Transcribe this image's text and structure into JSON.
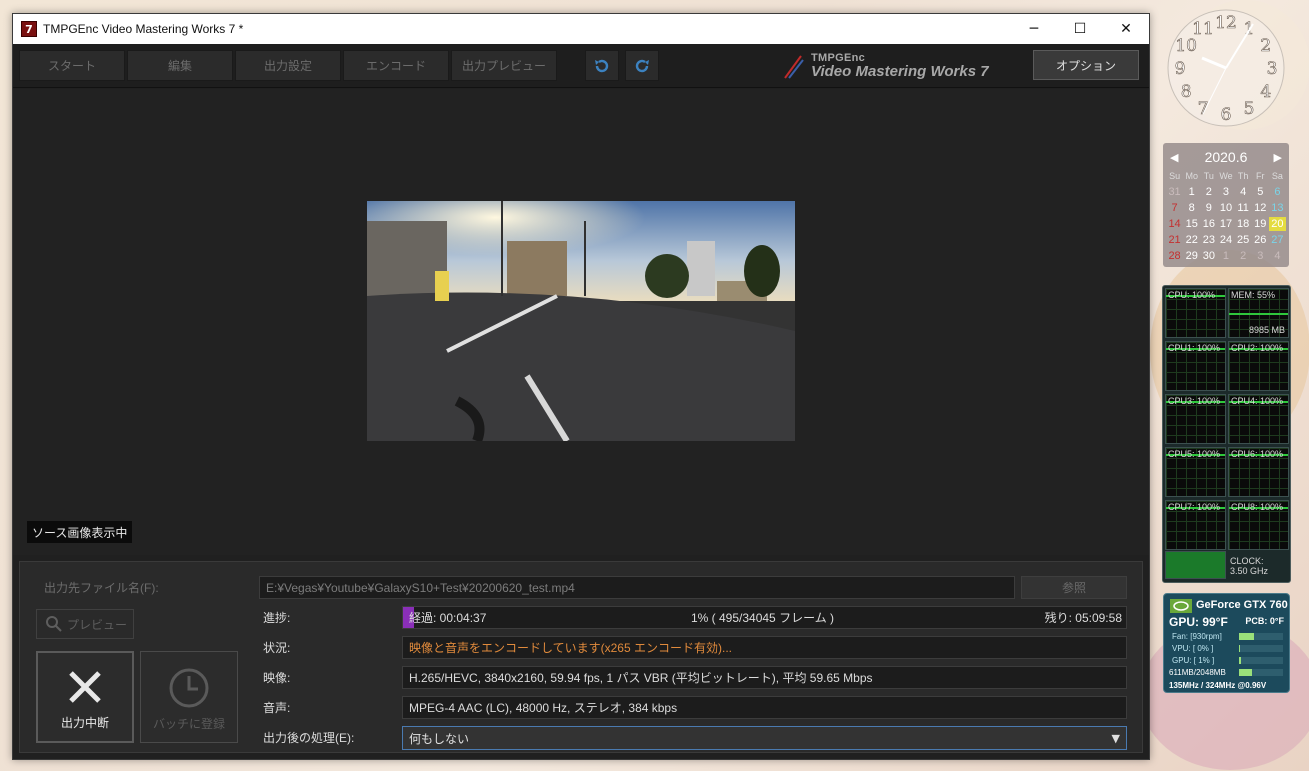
{
  "window": {
    "title": "TMPGEnc Video Mastering Works 7 *",
    "app_icon_letter": "7",
    "minimize_glyph": "─",
    "maximize_glyph": "☐",
    "close_glyph": "✕"
  },
  "toolbar": {
    "steps": [
      "スタート",
      "編集",
      "出力設定",
      "エンコード",
      "出力プレビュー"
    ],
    "undo_icon": "undo-icon",
    "redo_icon": "redo-icon",
    "logo_small": "TMPGEnc",
    "logo_big": "Video Mastering Works 7",
    "options_label": "オプション"
  },
  "preview": {
    "source_badge": "ソース画像表示中"
  },
  "output": {
    "file_label": "出力先ファイル名(F):",
    "file_path": "E:¥Vegas¥Youtube¥GalaxyS10+Test¥20200620_test.mp4",
    "browse_label": "参照",
    "preview_button": "プレビュー",
    "stop_button": "出力中断",
    "batch_button": "バッチに登録",
    "progress_label": "進捗:",
    "progress_elapsed": "経過: 00:04:37",
    "progress_center": "1% ( 495/34045 フレーム )",
    "progress_remaining": "残り: 05:09:58",
    "progress_fraction": 0.01454,
    "status_label": "状況:",
    "status_value": "映像と音声をエンコードしています(x265 エンコード有効)...",
    "video_label": "映像:",
    "video_value": "H.265/HEVC, 3840x2160, 59.94 fps, 1 パス VBR (平均ビットレート), 平均 59.65 Mbps",
    "audio_label": "音声:",
    "audio_value": "MPEG-4 AAC (LC), 48000 Hz, ステレオ, 384 kbps",
    "after_label": "出力後の処理(E):",
    "after_value": "何もしない",
    "colors": {
      "progress": "#8a2fb8",
      "status_text": "#e08a3c"
    }
  },
  "clock_gadget": {
    "numerals": [
      "12",
      "1",
      "2",
      "3",
      "4",
      "5",
      "6",
      "7",
      "8",
      "9",
      "10",
      "11"
    ]
  },
  "calendar": {
    "month": "2020.6",
    "prev_glyph": "◀",
    "next_glyph": "▶",
    "weekdays": [
      "Su",
      "Mo",
      "Tu",
      "We",
      "Th",
      "Fr",
      "Sa"
    ],
    "weeks": [
      [
        "31",
        "1",
        "2",
        "3",
        "4",
        "5",
        "6"
      ],
      [
        "7",
        "8",
        "9",
        "10",
        "11",
        "12",
        "13"
      ],
      [
        "14",
        "15",
        "16",
        "17",
        "18",
        "19",
        "20"
      ],
      [
        "21",
        "22",
        "23",
        "24",
        "25",
        "26",
        "27"
      ],
      [
        "28",
        "29",
        "30",
        "1",
        "2",
        "3",
        "4"
      ]
    ],
    "today": "20"
  },
  "cpu_meter": {
    "cpu_total": "CPU: 100%",
    "mem": "MEM: 55%",
    "mem_used": "8985 MB",
    "cores": [
      "CPU1: 100%",
      "CPU2: 100%",
      "CPU3: 100%",
      "CPU4: 100%",
      "CPU5: 100%",
      "CPU6: 100%",
      "CPU7: 100%",
      "CPU8: 100%"
    ],
    "clock_label": "CLOCK:",
    "clock_value": "3.50 GHz"
  },
  "gpu_meter": {
    "name": "GeForce GTX 760",
    "temp": "GPU: 99°F",
    "pcb": "PCB: 0°F",
    "fan": "Fan: [930rpm]",
    "vpu": "VPU: [ 0% ]",
    "gpu_load": "GPU: [ 1% ]",
    "memory": "611MB/2048MB",
    "clocks": "135MHz / 324MHz @0.96V"
  }
}
